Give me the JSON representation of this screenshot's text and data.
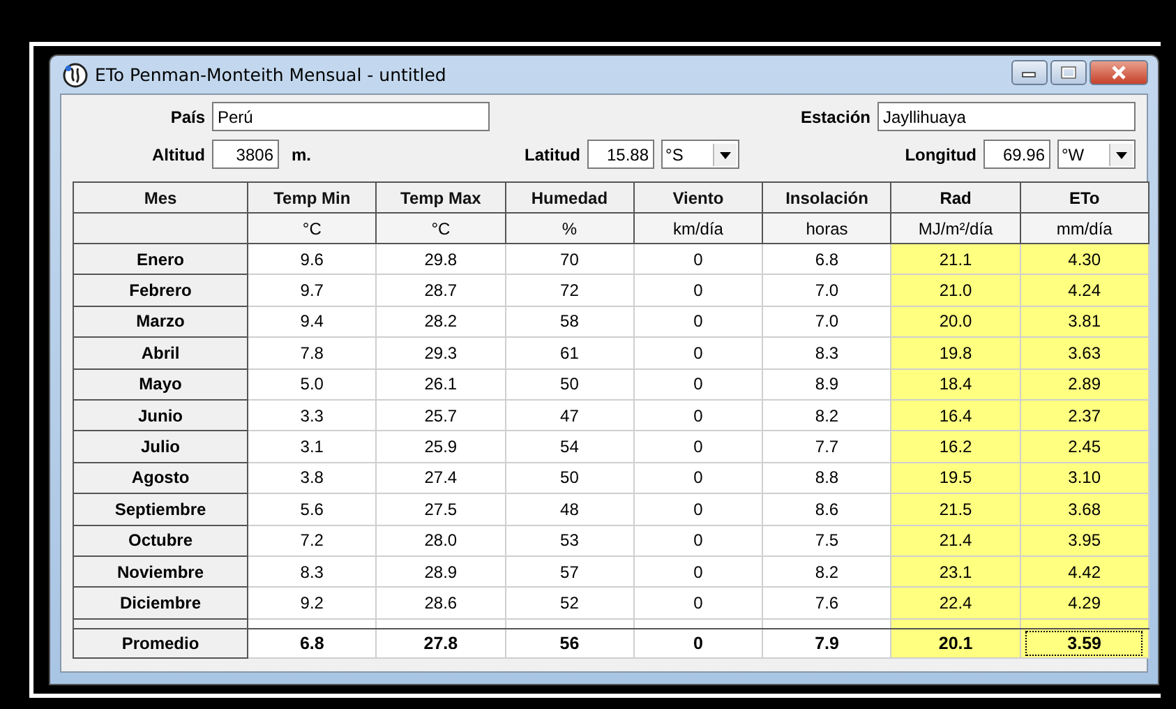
{
  "window": {
    "title": "ETo Penman-Monteith Mensual - untitled"
  },
  "form": {
    "country": {
      "label": "País",
      "value": "Perú"
    },
    "station": {
      "label": "Estación",
      "value": "Jayllihuaya"
    },
    "altitude": {
      "label": "Altitud",
      "value": "3806",
      "unit": "m."
    },
    "latitude": {
      "label": "Latitud",
      "value": "15.88",
      "hemisphere": "°S"
    },
    "longitude": {
      "label": "Longitud",
      "value": "69.96",
      "hemisphere": "°W"
    }
  },
  "table": {
    "columns": [
      {
        "name": "Mes",
        "highlighted": false
      },
      {
        "name": "Temp Min",
        "unit": "°C",
        "highlighted": false
      },
      {
        "name": "Temp Max",
        "unit": "°C",
        "highlighted": false
      },
      {
        "name": "Humedad",
        "unit": "%",
        "highlighted": false
      },
      {
        "name": "Viento",
        "unit": "km/día",
        "highlighted": false
      },
      {
        "name": "Insolación",
        "unit": "horas",
        "highlighted": false
      },
      {
        "name": "Rad",
        "unit": "MJ/m²/día",
        "highlighted": true
      },
      {
        "name": "ETo",
        "unit": "mm/día",
        "highlighted": true
      }
    ],
    "rows": [
      {
        "month": "Enero",
        "values": [
          "9.6",
          "29.8",
          "70",
          "0",
          "6.8",
          "21.1",
          "4.30"
        ]
      },
      {
        "month": "Febrero",
        "values": [
          "9.7",
          "28.7",
          "72",
          "0",
          "7.0",
          "21.0",
          "4.24"
        ]
      },
      {
        "month": "Marzo",
        "values": [
          "9.4",
          "28.2",
          "58",
          "0",
          "7.0",
          "20.0",
          "3.81"
        ]
      },
      {
        "month": "Abril",
        "values": [
          "7.8",
          "29.3",
          "61",
          "0",
          "8.3",
          "19.8",
          "3.63"
        ]
      },
      {
        "month": "Mayo",
        "values": [
          "5.0",
          "26.1",
          "50",
          "0",
          "8.9",
          "18.4",
          "2.89"
        ]
      },
      {
        "month": "Junio",
        "values": [
          "3.3",
          "25.7",
          "47",
          "0",
          "8.2",
          "16.4",
          "2.37"
        ]
      },
      {
        "month": "Julio",
        "values": [
          "3.1",
          "25.9",
          "54",
          "0",
          "7.7",
          "16.2",
          "2.45"
        ]
      },
      {
        "month": "Agosto",
        "values": [
          "3.8",
          "27.4",
          "50",
          "0",
          "8.8",
          "19.5",
          "3.10"
        ]
      },
      {
        "month": "Septiembre",
        "values": [
          "5.6",
          "27.5",
          "48",
          "0",
          "8.6",
          "21.5",
          "3.68"
        ]
      },
      {
        "month": "Octubre",
        "values": [
          "7.2",
          "28.0",
          "53",
          "0",
          "7.5",
          "21.4",
          "3.95"
        ]
      },
      {
        "month": "Noviembre",
        "values": [
          "8.3",
          "28.9",
          "57",
          "0",
          "8.2",
          "23.1",
          "4.42"
        ]
      },
      {
        "month": "Diciembre",
        "values": [
          "9.2",
          "28.6",
          "52",
          "0",
          "7.6",
          "22.4",
          "4.29"
        ]
      }
    ],
    "summary": {
      "label": "Promedio",
      "cells": [
        {
          "value": "6.8",
          "focused": false
        },
        {
          "value": "27.8",
          "focused": false
        },
        {
          "value": "56",
          "focused": false
        },
        {
          "value": "0",
          "focused": false
        },
        {
          "value": "7.9",
          "focused": false
        },
        {
          "value": "20.1",
          "focused": false
        },
        {
          "value": "3.59",
          "focused": true
        }
      ]
    }
  }
}
